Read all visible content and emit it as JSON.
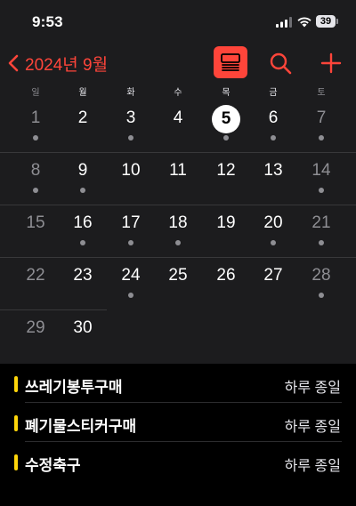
{
  "status_bar": {
    "time": "9:53",
    "battery": "39"
  },
  "nav": {
    "back_label": "2024년 9월",
    "accent_color": "#ff453a"
  },
  "weekdays": [
    "일",
    "월",
    "화",
    "수",
    "목",
    "금",
    "토"
  ],
  "calendar": {
    "weeks": [
      [
        {
          "day": "1",
          "dot": true
        },
        {
          "day": "2",
          "dot": false
        },
        {
          "day": "3",
          "dot": true
        },
        {
          "day": "4",
          "dot": false
        },
        {
          "day": "5",
          "dot": true,
          "today": true
        },
        {
          "day": "6",
          "dot": true
        },
        {
          "day": "7",
          "dot": true
        }
      ],
      [
        {
          "day": "8",
          "dot": true
        },
        {
          "day": "9",
          "dot": true
        },
        {
          "day": "10",
          "dot": false
        },
        {
          "day": "11",
          "dot": false
        },
        {
          "day": "12",
          "dot": false
        },
        {
          "day": "13",
          "dot": false
        },
        {
          "day": "14",
          "dot": true
        }
      ],
      [
        {
          "day": "15",
          "dot": false
        },
        {
          "day": "16",
          "dot": true
        },
        {
          "day": "17",
          "dot": true
        },
        {
          "day": "18",
          "dot": true
        },
        {
          "day": "19",
          "dot": false
        },
        {
          "day": "20",
          "dot": true
        },
        {
          "day": "21",
          "dot": true
        }
      ],
      [
        {
          "day": "22",
          "dot": false
        },
        {
          "day": "23",
          "dot": false
        },
        {
          "day": "24",
          "dot": true
        },
        {
          "day": "25",
          "dot": false
        },
        {
          "day": "26",
          "dot": false
        },
        {
          "day": "27",
          "dot": false
        },
        {
          "day": "28",
          "dot": true
        }
      ],
      [
        {
          "day": "29",
          "dot": false
        },
        {
          "day": "30",
          "dot": false
        }
      ]
    ]
  },
  "events": [
    {
      "title": "쓰레기봉투구매",
      "time": "하루 종일",
      "color": "#ffd60a"
    },
    {
      "title": "폐기물스티커구매",
      "time": "하루 종일",
      "color": "#ffd60a"
    },
    {
      "title": "수정축구",
      "time": "하루 종일",
      "color": "#ffd60a"
    }
  ]
}
